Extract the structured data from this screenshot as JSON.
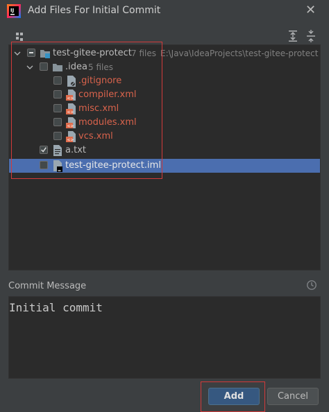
{
  "window": {
    "title": "Add Files For Initial Commit"
  },
  "tree": {
    "rows": [
      {
        "label": "test-gitee-protect",
        "count": "7 files",
        "path": "E:\\Java\\IdeaProjects\\test-gitee-protect",
        "state": "partial",
        "color": "#bbbbbb"
      },
      {
        "label": ".idea",
        "count": "5 files",
        "state": "unchecked",
        "color": "#bbbbbb"
      },
      {
        "label": ".gitignore",
        "state": "unchecked",
        "color": "#d9634c"
      },
      {
        "label": "compiler.xml",
        "state": "unchecked",
        "color": "#d9634c"
      },
      {
        "label": "misc.xml",
        "state": "unchecked",
        "color": "#d9634c"
      },
      {
        "label": "modules.xml",
        "state": "unchecked",
        "color": "#d9634c"
      },
      {
        "label": "vcs.xml",
        "state": "unchecked",
        "color": "#d9634c"
      },
      {
        "label": "a.txt",
        "state": "checked",
        "color": "#bbbbbb"
      },
      {
        "label": "test-gitee-protect.iml",
        "state": "unchecked",
        "color": "#bbbbbb",
        "selected": true
      }
    ]
  },
  "commit": {
    "label": "Commit Message",
    "message": "Initial commit"
  },
  "buttons": {
    "add": "Add",
    "cancel": "Cancel"
  },
  "colors": {
    "background": "#3c3f41",
    "panel": "#2b2b2b",
    "selection": "#4b6eaf",
    "unversioned": "#d9634c",
    "highlight": "#d23a3a",
    "primary_button": "#365880"
  }
}
